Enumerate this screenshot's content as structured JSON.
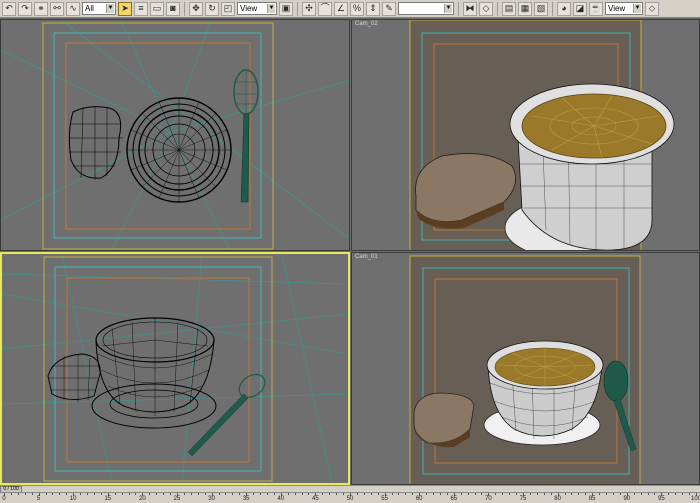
{
  "toolbar": {
    "selection_filter": "All",
    "reference_coord_1": "View",
    "reference_coord_2": "View",
    "named_selection": ""
  },
  "viewports": {
    "top_label": "",
    "cam02_label": "Cam_02",
    "persp_label": "",
    "cam01_label": "Cam_01"
  },
  "timeline": {
    "frame_indicator": "0 / 100",
    "ticks": [
      "0",
      "5",
      "10",
      "15",
      "20",
      "25",
      "30",
      "35",
      "40",
      "45",
      "50",
      "55",
      "60",
      "65",
      "70",
      "75",
      "80",
      "85",
      "90",
      "95",
      "100"
    ]
  },
  "colors": {
    "viewport_bg": "#6f6f6f",
    "safe_frame_cyan": "#3ec6c6",
    "safe_frame_yellow": "#d8c33a",
    "safe_frame_orange": "#d87a2a",
    "active_border": "#e8e85a",
    "wire_color": "#000000",
    "spoon_color": "#1f5a4a",
    "soup_color": "#9a7a2a"
  }
}
